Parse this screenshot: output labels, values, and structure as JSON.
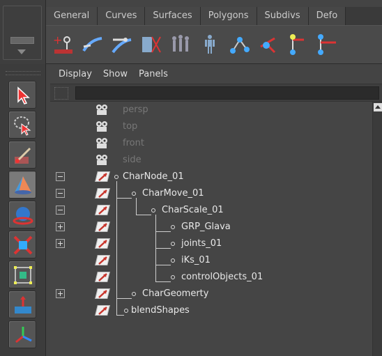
{
  "shelf": {
    "tabs": [
      "General",
      "Curves",
      "Surfaces",
      "Polygons",
      "Subdivs",
      "Defo"
    ]
  },
  "outliner": {
    "menu": [
      "Display",
      "Show",
      "Panels"
    ],
    "search": {
      "value": "",
      "placeholder": ""
    },
    "items": [
      {
        "label": "persp",
        "type": "camera"
      },
      {
        "label": "top",
        "type": "camera"
      },
      {
        "label": "front",
        "type": "camera"
      },
      {
        "label": "side",
        "type": "camera"
      },
      {
        "label": "CharNode_01",
        "type": "transform",
        "expander": "minus"
      },
      {
        "label": "CharMove_01",
        "type": "transform",
        "expander": "minus"
      },
      {
        "label": "CharScale_01",
        "type": "transform",
        "expander": "minus"
      },
      {
        "label": "GRP_Glava",
        "type": "transform",
        "expander": "plus"
      },
      {
        "label": "joints_01",
        "type": "transform",
        "expander": "plus"
      },
      {
        "label": "iKs_01",
        "type": "transform"
      },
      {
        "label": "controlObjects_01",
        "type": "transform"
      },
      {
        "label": "CharGeomerty",
        "type": "transform",
        "expander": "plus"
      },
      {
        "label": "blendShapes",
        "type": "transform"
      }
    ]
  },
  "colors": {
    "panel": "#444444",
    "accent_red": "#c8352c",
    "text": "#e8e8e8",
    "camera_text": "#777777"
  }
}
